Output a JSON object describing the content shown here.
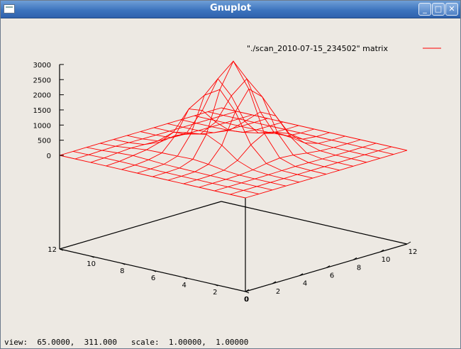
{
  "window": {
    "title": "Gnuplot",
    "buttons": {
      "minimize": "_",
      "maximize": "□",
      "close": "✕"
    }
  },
  "status": {
    "view_label": "view:",
    "view_values": "65.0000,  311.000",
    "scale_label": "scale:",
    "scale_values": "1.00000,  1.00000"
  },
  "chart_data": {
    "type": "surface",
    "legend": {
      "label": "\"./scan_2010-07-15_234502\" matrix",
      "placement": "top-right",
      "color": "#ff0000"
    },
    "z_ticks": [
      "3000",
      "2500",
      "2000",
      "1500",
      "1000",
      "500",
      "0"
    ],
    "x_ticks": [
      "0",
      "2",
      "4",
      "6",
      "8",
      "10",
      "12"
    ],
    "y_ticks": [
      "0",
      "2",
      "4",
      "6",
      "8",
      "10",
      "12"
    ],
    "xrange": [
      0,
      12
    ],
    "yrange": [
      0,
      12
    ],
    "zrange": [
      0,
      3000
    ],
    "grid_size": 13,
    "peak": {
      "x": 6,
      "y": 6,
      "z": 3000
    },
    "colors": {
      "surface": "#ff0000",
      "axes": "#000000"
    }
  }
}
